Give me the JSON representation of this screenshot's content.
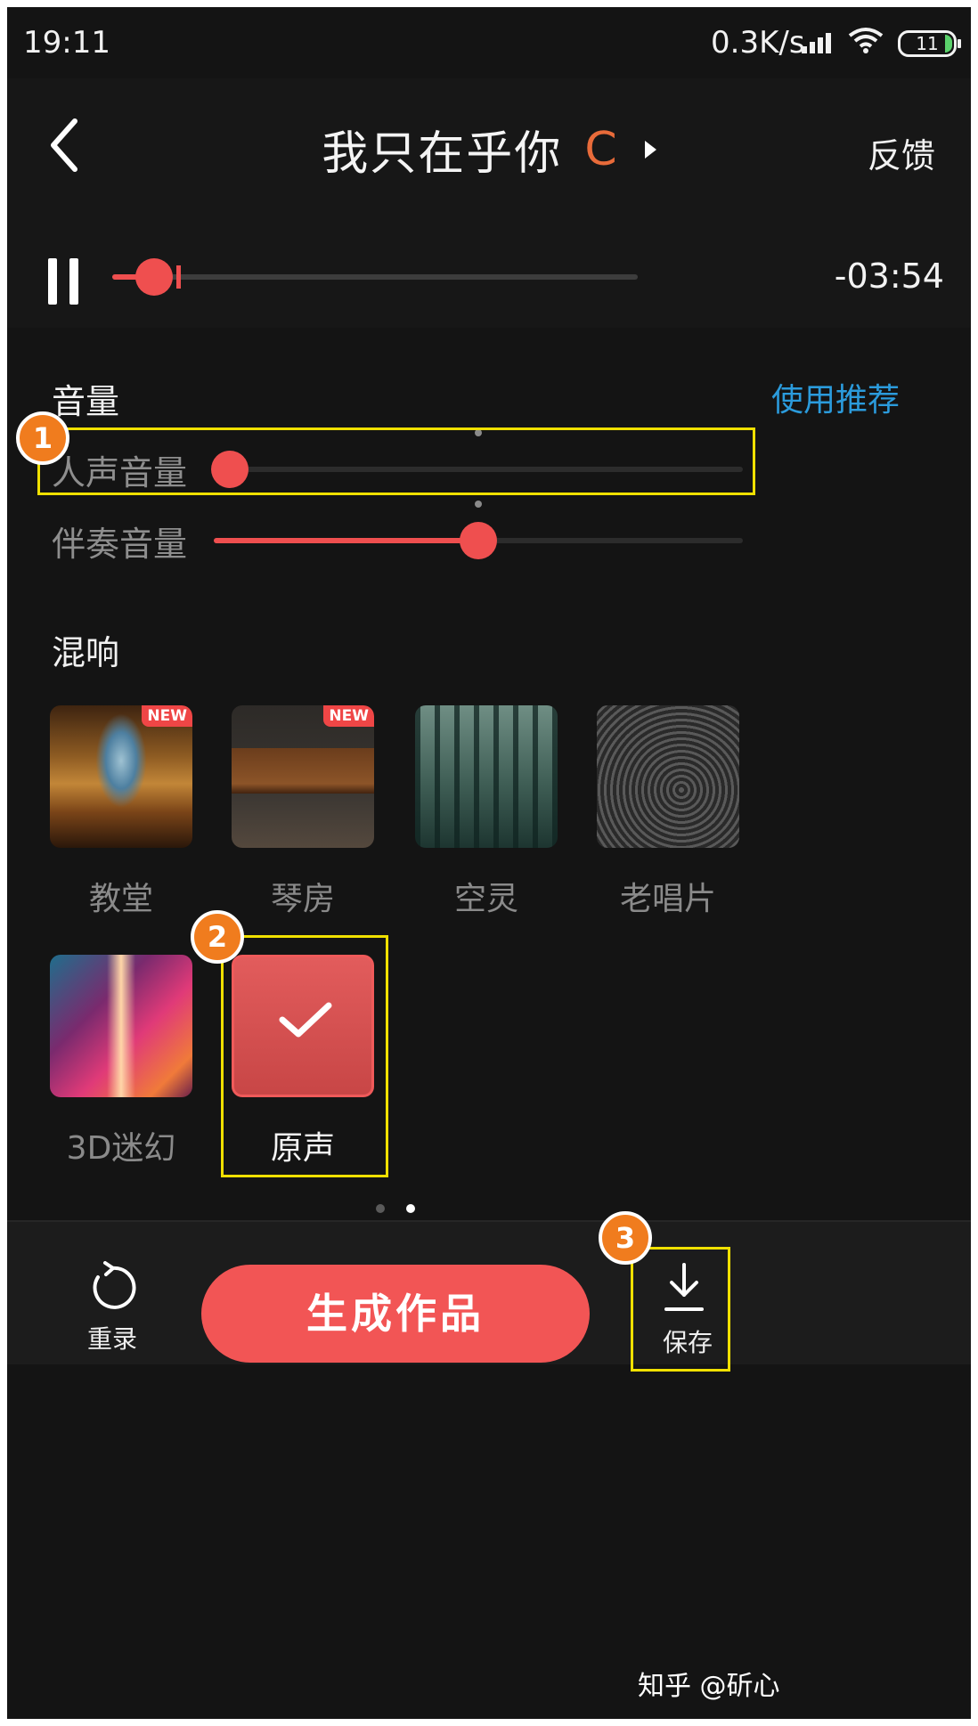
{
  "status_bar": {
    "time": "19:11",
    "network_speed": "0.3K/s",
    "battery": "11"
  },
  "header": {
    "title": "我只在乎你",
    "title_suffix": "C",
    "feedback_label": "反馈"
  },
  "player": {
    "remaining_time": "-03:54",
    "progress": 0.08
  },
  "volume": {
    "title": "音量",
    "recommend_label": "使用推荐",
    "vocal_label": "人声音量",
    "vocal_level": 0.03,
    "accompaniment_label": "伴奏音量",
    "accompaniment_level": 0.5
  },
  "reverb": {
    "title": "混响",
    "new_badge": "NEW",
    "items": [
      {
        "label": "教堂",
        "badge": "NEW"
      },
      {
        "label": "琴房",
        "badge": "NEW"
      },
      {
        "label": "空灵"
      },
      {
        "label": "老唱片"
      },
      {
        "label": "3D迷幻"
      },
      {
        "label": "原声",
        "selected": true
      }
    ]
  },
  "pager": {
    "pages": 2,
    "current": 2
  },
  "bottom_bar": {
    "rerecord_label": "重录",
    "generate_label": "生成作品",
    "save_label": "保存"
  },
  "annotations": {
    "markers": [
      "1",
      "2",
      "3"
    ],
    "highlight_color": "#f0e000",
    "marker_color": "#f07c1e"
  },
  "accent_color": "#ef4f4f",
  "link_color": "#2b9bdc",
  "credit": "知乎 @斫心"
}
